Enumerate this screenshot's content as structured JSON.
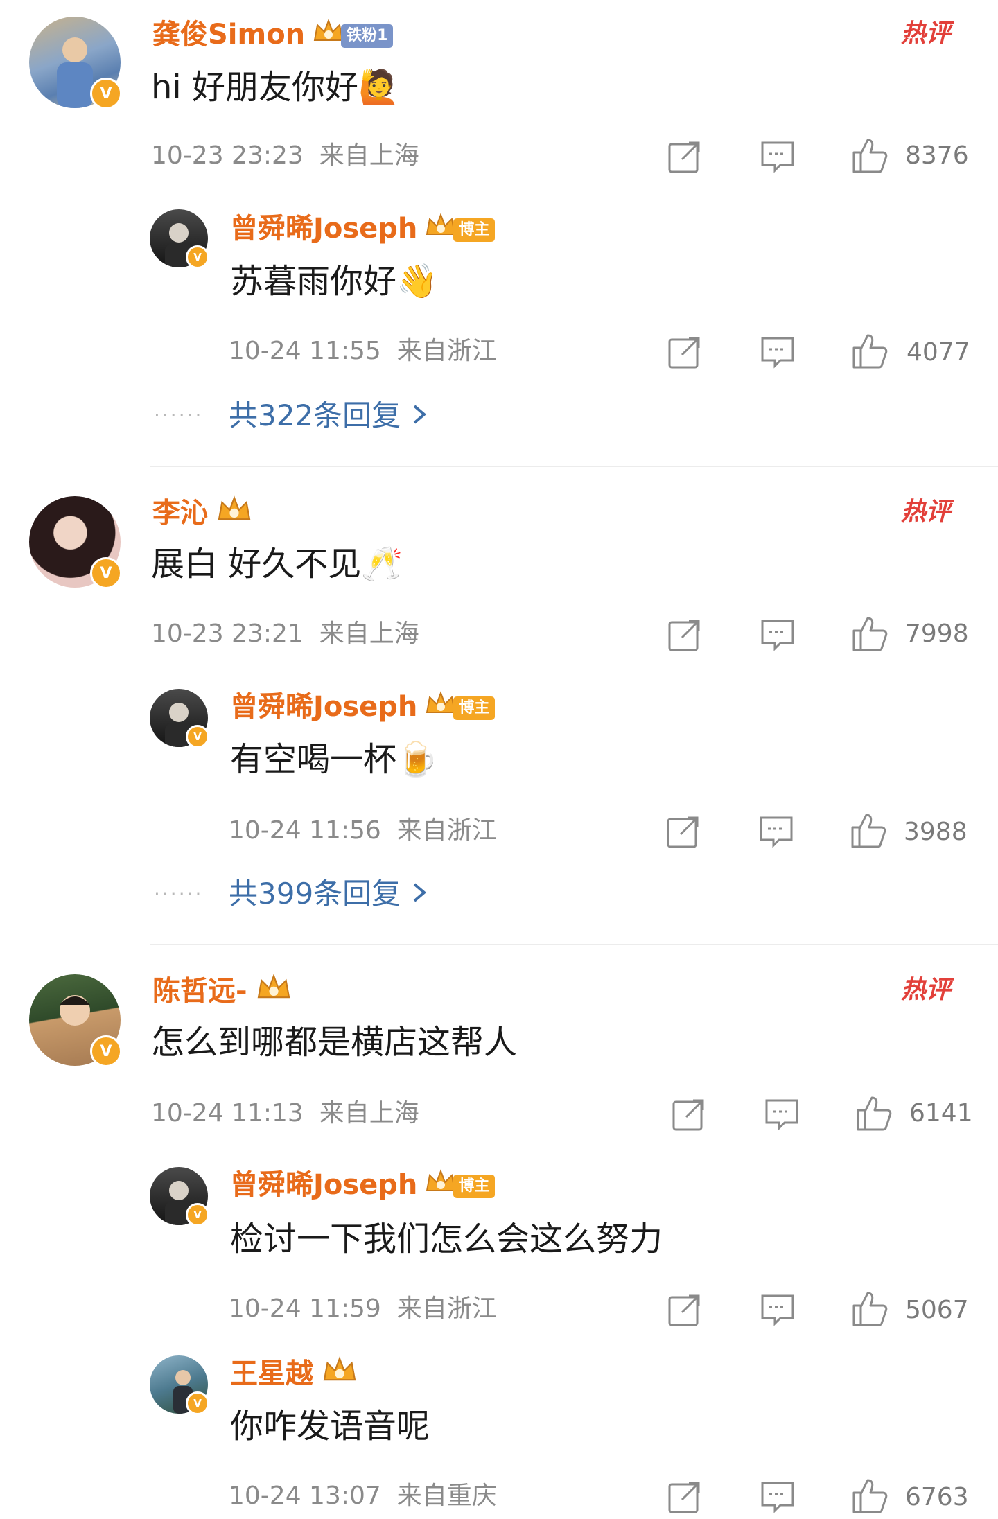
{
  "icons": {
    "crown": "crown-icon",
    "share": "share-icon",
    "comment": "comment-icon",
    "like": "like-icon",
    "verified": "verified-badge-icon",
    "chevron": "chevron-right-icon"
  },
  "colors": {
    "name": "#e86b1a",
    "reply_link": "#3d6ea8",
    "hot": "#e2403a"
  },
  "hot_label": "热评",
  "threads": [
    {
      "name": "龚俊Simon",
      "tag": "铁粉1",
      "text": "hi 好朋友你好🙋",
      "time": "10-23 23:23",
      "location": "来自上海",
      "likes": "8376",
      "replies": [
        {
          "name": "曾舜晞Joseph",
          "tag": "博主",
          "text": "苏暮雨你好👋",
          "time": "10-24 11:55",
          "location": "来自浙江",
          "likes": "4077"
        }
      ],
      "more_replies": "共322条回复"
    },
    {
      "name": "李沁",
      "text": "展白 好久不见🥂",
      "time": "10-23 23:21",
      "location": "来自上海",
      "likes": "7998",
      "replies": [
        {
          "name": "曾舜晞Joseph",
          "tag": "博主",
          "text": "有空喝一杯🍺",
          "time": "10-24 11:56",
          "location": "来自浙江",
          "likes": "3988"
        }
      ],
      "more_replies": "共399条回复"
    },
    {
      "name": "陈哲远-",
      "text": "怎么到哪都是横店这帮人",
      "time": "10-24 11:13",
      "location": "来自上海",
      "likes": "6141",
      "replies": [
        {
          "name": "曾舜晞Joseph",
          "tag": "博主",
          "text": "检讨一下我们怎么会这么努力",
          "time": "10-24 11:59",
          "location": "来自浙江",
          "likes": "5067"
        },
        {
          "name": "王星越",
          "text": "你咋发语音呢",
          "time": "10-24 13:07",
          "location": "来自重庆",
          "likes": "6763"
        }
      ]
    }
  ]
}
